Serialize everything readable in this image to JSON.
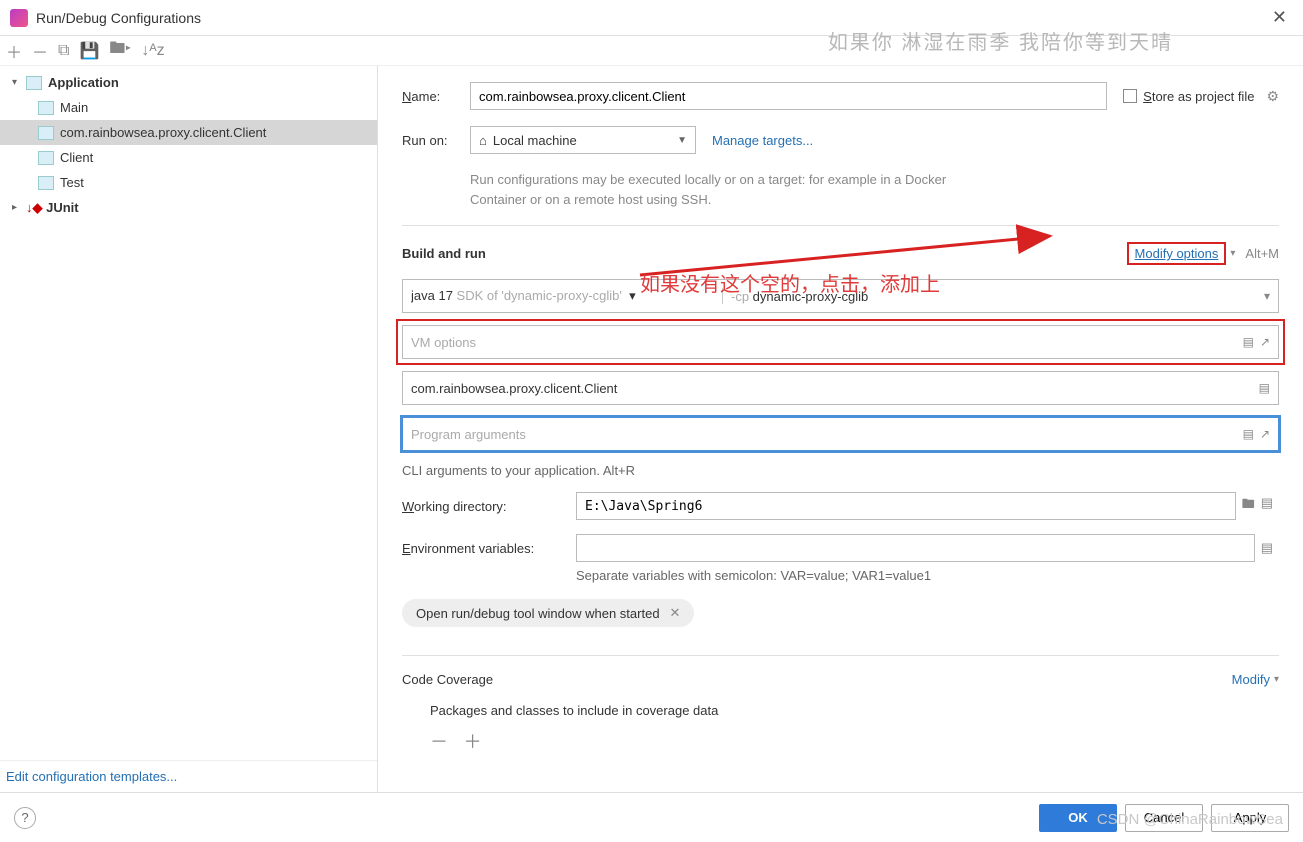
{
  "window": {
    "title": "Run/Debug Configurations"
  },
  "watermark": {
    "top": "如果你 淋湿在雨季  我陪你等到天晴",
    "bottom": "CSDN @ChinaRainbowSea"
  },
  "tree": {
    "app_label": "Application",
    "items": [
      "Main",
      "com.rainbowsea.proxy.clicent.Client",
      "Client",
      "Test"
    ],
    "selected_index": 1,
    "junit_label": "JUnit"
  },
  "edit_templates": "Edit configuration templates...",
  "form": {
    "name_label": "Name:",
    "name_value": "com.rainbowsea.proxy.clicent.Client",
    "store_label": "Store as project file",
    "runon_label": "Run on:",
    "runon_value": "Local machine",
    "manage_targets": "Manage targets...",
    "runon_hint": "Run configurations may be executed locally or on a target: for example in a Docker Container or on a remote host using SSH.",
    "build_run": "Build and run",
    "modify_options": "Modify options",
    "modify_shortcut": "Alt+M",
    "sdk_prefix": "java 17 ",
    "sdk_hint": "SDK of 'dynamic-proxy-cglib'",
    "cp_prefix": "-cp ",
    "cp_value": "dynamic-proxy-cglib",
    "vm_placeholder": "VM options",
    "main_class": "com.rainbowsea.proxy.clicent.Client",
    "args_placeholder": "Program arguments",
    "cli_hint": "CLI arguments to your application. Alt+R",
    "wd_label": "Working directory:",
    "wd_value": "E:\\Java\\Spring6",
    "env_label": "Environment variables:",
    "env_hint": "Separate variables with semicolon: VAR=value; VAR1=value1",
    "open_tool_window": "Open run/debug tool window when started",
    "code_coverage": "Code Coverage",
    "cc_modify": "Modify",
    "packages_label": "Packages and classes to include in coverage data"
  },
  "annotation": "如果没有这个空的，点击，添加上",
  "buttons": {
    "ok": "OK",
    "cancel": "Cancel",
    "apply": "Apply"
  }
}
